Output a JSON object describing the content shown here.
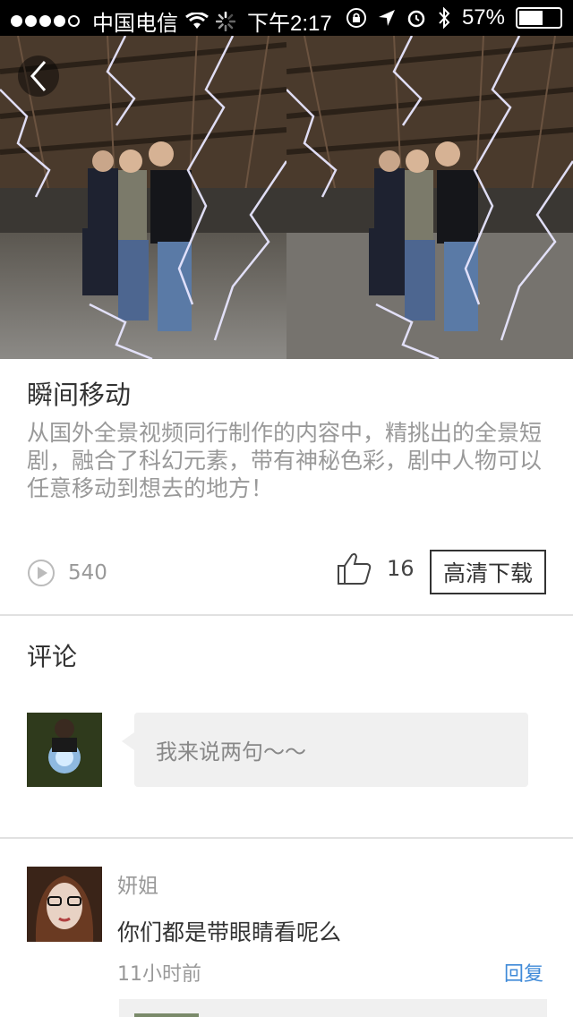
{
  "status_bar": {
    "carrier": "中国电信",
    "time": "下午2:17",
    "battery": "57%"
  },
  "video": {
    "back_icon": "chevron-left-icon"
  },
  "post": {
    "title": "瞬间移动",
    "description": "从国外全景视频同行制作的内容中，精挑出的全景短剧，融合了科幻元素，带有神秘色彩，剧中人物可以任意移动到想去的地方！",
    "views": "540",
    "likes": "16",
    "download_label": "高清下载"
  },
  "comments": {
    "section_title": "评论",
    "input_placeholder": "我来说两句～～",
    "items": [
      {
        "name": "妍姐",
        "text": "你们都是带眼睛看呢么",
        "time": "11小时前",
        "reply_label": "回复"
      }
    ]
  }
}
